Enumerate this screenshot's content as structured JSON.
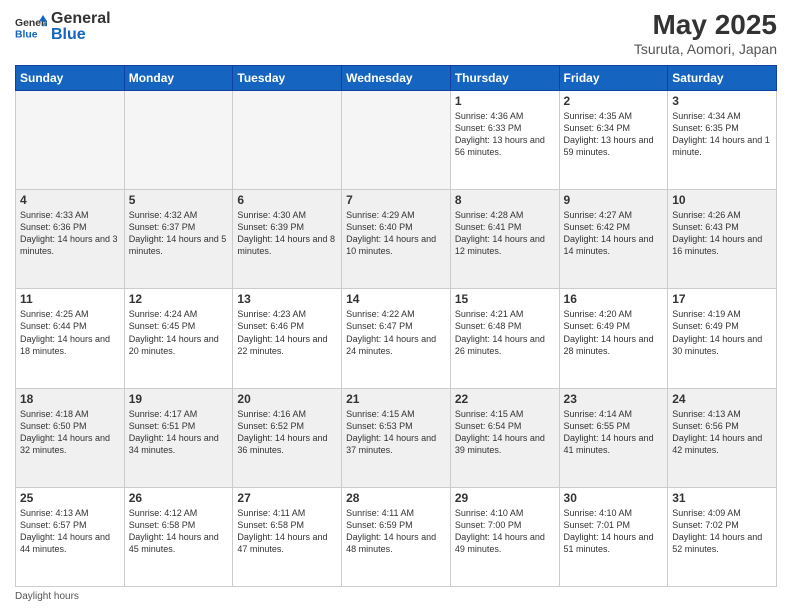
{
  "header": {
    "logo_general": "General",
    "logo_blue": "Blue",
    "month_year": "May 2025",
    "location": "Tsuruta, Aomori, Japan"
  },
  "weekdays": [
    "Sunday",
    "Monday",
    "Tuesday",
    "Wednesday",
    "Thursday",
    "Friday",
    "Saturday"
  ],
  "weeks": [
    [
      {
        "day": "",
        "empty": true
      },
      {
        "day": "",
        "empty": true
      },
      {
        "day": "",
        "empty": true
      },
      {
        "day": "",
        "empty": true
      },
      {
        "day": "1",
        "sunrise": "4:36 AM",
        "sunset": "6:33 PM",
        "daylight": "13 hours and 56 minutes."
      },
      {
        "day": "2",
        "sunrise": "4:35 AM",
        "sunset": "6:34 PM",
        "daylight": "13 hours and 59 minutes."
      },
      {
        "day": "3",
        "sunrise": "4:34 AM",
        "sunset": "6:35 PM",
        "daylight": "14 hours and 1 minute."
      }
    ],
    [
      {
        "day": "4",
        "sunrise": "4:33 AM",
        "sunset": "6:36 PM",
        "daylight": "14 hours and 3 minutes."
      },
      {
        "day": "5",
        "sunrise": "4:32 AM",
        "sunset": "6:37 PM",
        "daylight": "14 hours and 5 minutes."
      },
      {
        "day": "6",
        "sunrise": "4:30 AM",
        "sunset": "6:39 PM",
        "daylight": "14 hours and 8 minutes."
      },
      {
        "day": "7",
        "sunrise": "4:29 AM",
        "sunset": "6:40 PM",
        "daylight": "14 hours and 10 minutes."
      },
      {
        "day": "8",
        "sunrise": "4:28 AM",
        "sunset": "6:41 PM",
        "daylight": "14 hours and 12 minutes."
      },
      {
        "day": "9",
        "sunrise": "4:27 AM",
        "sunset": "6:42 PM",
        "daylight": "14 hours and 14 minutes."
      },
      {
        "day": "10",
        "sunrise": "4:26 AM",
        "sunset": "6:43 PM",
        "daylight": "14 hours and 16 minutes."
      }
    ],
    [
      {
        "day": "11",
        "sunrise": "4:25 AM",
        "sunset": "6:44 PM",
        "daylight": "14 hours and 18 minutes."
      },
      {
        "day": "12",
        "sunrise": "4:24 AM",
        "sunset": "6:45 PM",
        "daylight": "14 hours and 20 minutes."
      },
      {
        "day": "13",
        "sunrise": "4:23 AM",
        "sunset": "6:46 PM",
        "daylight": "14 hours and 22 minutes."
      },
      {
        "day": "14",
        "sunrise": "4:22 AM",
        "sunset": "6:47 PM",
        "daylight": "14 hours and 24 minutes."
      },
      {
        "day": "15",
        "sunrise": "4:21 AM",
        "sunset": "6:48 PM",
        "daylight": "14 hours and 26 minutes."
      },
      {
        "day": "16",
        "sunrise": "4:20 AM",
        "sunset": "6:49 PM",
        "daylight": "14 hours and 28 minutes."
      },
      {
        "day": "17",
        "sunrise": "4:19 AM",
        "sunset": "6:49 PM",
        "daylight": "14 hours and 30 minutes."
      }
    ],
    [
      {
        "day": "18",
        "sunrise": "4:18 AM",
        "sunset": "6:50 PM",
        "daylight": "14 hours and 32 minutes."
      },
      {
        "day": "19",
        "sunrise": "4:17 AM",
        "sunset": "6:51 PM",
        "daylight": "14 hours and 34 minutes."
      },
      {
        "day": "20",
        "sunrise": "4:16 AM",
        "sunset": "6:52 PM",
        "daylight": "14 hours and 36 minutes."
      },
      {
        "day": "21",
        "sunrise": "4:15 AM",
        "sunset": "6:53 PM",
        "daylight": "14 hours and 37 minutes."
      },
      {
        "day": "22",
        "sunrise": "4:15 AM",
        "sunset": "6:54 PM",
        "daylight": "14 hours and 39 minutes."
      },
      {
        "day": "23",
        "sunrise": "4:14 AM",
        "sunset": "6:55 PM",
        "daylight": "14 hours and 41 minutes."
      },
      {
        "day": "24",
        "sunrise": "4:13 AM",
        "sunset": "6:56 PM",
        "daylight": "14 hours and 42 minutes."
      }
    ],
    [
      {
        "day": "25",
        "sunrise": "4:13 AM",
        "sunset": "6:57 PM",
        "daylight": "14 hours and 44 minutes."
      },
      {
        "day": "26",
        "sunrise": "4:12 AM",
        "sunset": "6:58 PM",
        "daylight": "14 hours and 45 minutes."
      },
      {
        "day": "27",
        "sunrise": "4:11 AM",
        "sunset": "6:58 PM",
        "daylight": "14 hours and 47 minutes."
      },
      {
        "day": "28",
        "sunrise": "4:11 AM",
        "sunset": "6:59 PM",
        "daylight": "14 hours and 48 minutes."
      },
      {
        "day": "29",
        "sunrise": "4:10 AM",
        "sunset": "7:00 PM",
        "daylight": "14 hours and 49 minutes."
      },
      {
        "day": "30",
        "sunrise": "4:10 AM",
        "sunset": "7:01 PM",
        "daylight": "14 hours and 51 minutes."
      },
      {
        "day": "31",
        "sunrise": "4:09 AM",
        "sunset": "7:02 PM",
        "daylight": "14 hours and 52 minutes."
      }
    ]
  ],
  "footer": "Daylight hours"
}
